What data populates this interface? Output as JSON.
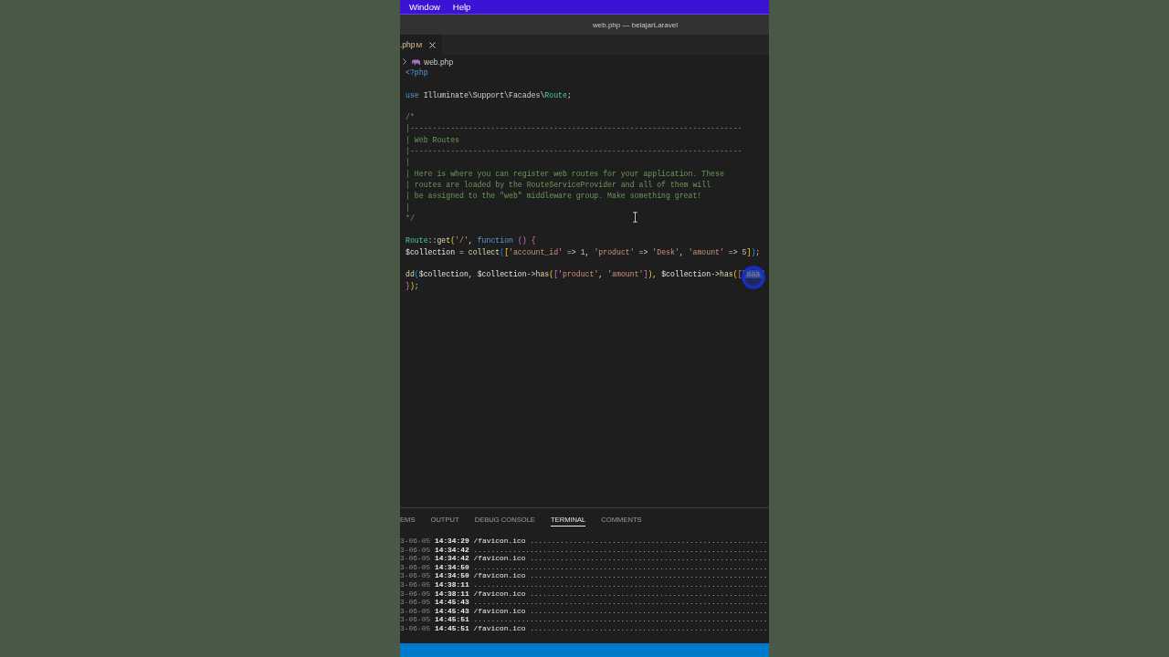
{
  "menu": [
    "Window",
    "Help"
  ],
  "window": {
    "title": "web.php — belajarLaravel"
  },
  "tabs": [
    {
      "label": ".php",
      "status": "M",
      "selected": true
    }
  ],
  "breadcrumb": {
    "file": "web.php"
  },
  "code_lines": [
    {
      "kind": "code",
      "tokens": [
        {
          "kind": "tag",
          "text": "<?php"
        }
      ]
    },
    {
      "kind": "blank"
    },
    {
      "kind": "code",
      "tokens": [
        {
          "kind": "keyword",
          "text": "use"
        },
        {
          "kind": "plain",
          "text": " Illuminate\\Support\\Facades\\"
        },
        {
          "kind": "class",
          "text": "Route"
        },
        {
          "kind": "plain",
          "text": ";"
        }
      ]
    },
    {
      "kind": "blank"
    },
    {
      "kind": "code",
      "tokens": [
        {
          "kind": "comment",
          "text": "/*"
        }
      ]
    },
    {
      "kind": "code",
      "tokens": [
        {
          "kind": "comment",
          "text": "|--------------------------------------------------------------------------"
        }
      ]
    },
    {
      "kind": "code",
      "tokens": [
        {
          "kind": "comment",
          "text": "| Web Routes"
        }
      ]
    },
    {
      "kind": "code",
      "tokens": [
        {
          "kind": "comment",
          "text": "|--------------------------------------------------------------------------"
        }
      ]
    },
    {
      "kind": "code",
      "tokens": [
        {
          "kind": "comment",
          "text": "|"
        }
      ]
    },
    {
      "kind": "code",
      "tokens": [
        {
          "kind": "comment",
          "text": "| Here is where you can register web routes for your application. These"
        }
      ]
    },
    {
      "kind": "code",
      "tokens": [
        {
          "kind": "comment",
          "text": "| routes are loaded by the RouteServiceProvider and all of them will"
        }
      ]
    },
    {
      "kind": "code",
      "tokens": [
        {
          "kind": "comment",
          "text": "| be assigned to the \"web\" middleware group. Make something great!"
        }
      ]
    },
    {
      "kind": "code",
      "tokens": [
        {
          "kind": "comment",
          "text": "|"
        }
      ]
    },
    {
      "kind": "code",
      "tokens": [
        {
          "kind": "comment",
          "text": "*/"
        }
      ]
    },
    {
      "kind": "blank"
    },
    {
      "kind": "code",
      "tokens": [
        {
          "kind": "class",
          "text": "Route"
        },
        {
          "kind": "plain",
          "text": "::"
        },
        {
          "kind": "method",
          "text": "get"
        },
        {
          "kind": "bracket1",
          "text": "("
        },
        {
          "kind": "string",
          "text": "'/'"
        },
        {
          "kind": "plain",
          "text": ", "
        },
        {
          "kind": "keyword",
          "text": "function"
        },
        {
          "kind": "bracket2",
          "text": " ()"
        },
        {
          "kind": "bracket2",
          "text": " {"
        }
      ]
    },
    {
      "kind": "code",
      "tokens": [
        {
          "kind": "variable",
          "text": "$collection"
        },
        {
          "kind": "plain",
          "text": " = "
        },
        {
          "kind": "method",
          "text": "collect"
        },
        {
          "kind": "bracket3",
          "text": "("
        },
        {
          "kind": "bracket1",
          "text": "["
        },
        {
          "kind": "string",
          "text": "'account_id'"
        },
        {
          "kind": "plain",
          "text": " => "
        },
        {
          "kind": "number",
          "text": "1"
        },
        {
          "kind": "plain",
          "text": ", "
        },
        {
          "kind": "string",
          "text": "'product'"
        },
        {
          "kind": "plain",
          "text": " => "
        },
        {
          "kind": "string",
          "text": "'Desk'"
        },
        {
          "kind": "plain",
          "text": ", "
        },
        {
          "kind": "string",
          "text": "'amount'"
        },
        {
          "kind": "plain",
          "text": " => "
        },
        {
          "kind": "number",
          "text": "5"
        },
        {
          "kind": "bracket1",
          "text": "]"
        },
        {
          "kind": "bracket3",
          "text": ")"
        },
        {
          "kind": "plain",
          "text": ";"
        }
      ]
    },
    {
      "kind": "blank"
    },
    {
      "kind": "code",
      "tokens": [
        {
          "kind": "method",
          "text": "dd"
        },
        {
          "kind": "bracket3",
          "text": "("
        },
        {
          "kind": "variable",
          "text": "$collection"
        },
        {
          "kind": "plain",
          "text": ", "
        },
        {
          "kind": "variable",
          "text": "$collection"
        },
        {
          "kind": "plain",
          "text": "->"
        },
        {
          "kind": "method",
          "text": "has"
        },
        {
          "kind": "bracket1",
          "text": "("
        },
        {
          "kind": "bracket2",
          "text": "["
        },
        {
          "kind": "string",
          "text": "'product'"
        },
        {
          "kind": "plain",
          "text": ", "
        },
        {
          "kind": "string",
          "text": "'amount'"
        },
        {
          "kind": "bracket2",
          "text": "]"
        },
        {
          "kind": "bracket1",
          "text": ")"
        },
        {
          "kind": "plain",
          "text": ", "
        },
        {
          "kind": "variable",
          "text": "$collection"
        },
        {
          "kind": "plain",
          "text": "->"
        },
        {
          "kind": "method",
          "text": "has"
        },
        {
          "kind": "bracket1",
          "text": "("
        },
        {
          "kind": "bracket2",
          "text": "["
        },
        {
          "kind": "selection",
          "text": "'aaa'"
        }
      ]
    },
    {
      "kind": "code",
      "tokens": [
        {
          "kind": "bracket2",
          "text": "}"
        },
        {
          "kind": "bracket1",
          "text": ")"
        },
        {
          "kind": "plain",
          "text": ";"
        }
      ]
    }
  ],
  "panel": {
    "tabs": [
      {
        "label": "EMS",
        "selected": false
      },
      {
        "label": "OUTPUT",
        "selected": false
      },
      {
        "label": "DEBUG CONSOLE",
        "selected": false
      },
      {
        "label": "TERMINAL",
        "selected": true
      },
      {
        "label": "COMMENTS",
        "selected": false
      }
    ],
    "terminal_lines": [
      {
        "date": "3-06-05",
        "time": "14:34:29",
        "path": "/favicon.ico",
        "dots": "......................................................."
      },
      {
        "date": "3-06-05",
        "time": "14:34:42",
        "dots": "...................................................................."
      },
      {
        "date": "3-06-05",
        "time": "14:34:42",
        "path": "/favicon.ico",
        "dots": "......................................................."
      },
      {
        "date": "3-06-05",
        "time": "14:34:50",
        "dots": "...................................................................."
      },
      {
        "date": "3-06-05",
        "time": "14:34:50",
        "path": "/favicon.ico",
        "dots": "......................................................."
      },
      {
        "date": "3-06-05",
        "time": "14:38:11",
        "dots": "...................................................................."
      },
      {
        "date": "3-06-05",
        "time": "14:38:11",
        "path": "/favicon.ico",
        "dots": "......................................................."
      },
      {
        "date": "3-06-05",
        "time": "14:45:43",
        "dots": "...................................................................."
      },
      {
        "date": "3-06-05",
        "time": "14:45:43",
        "path": "/favicon.ico",
        "dots": "......................................................."
      },
      {
        "date": "3-06-05",
        "time": "14:45:51",
        "dots": "...................................................................."
      },
      {
        "date": "3-06-05",
        "time": "14:45:51",
        "path": "/favicon.ico",
        "dots": "......................................................."
      }
    ]
  }
}
